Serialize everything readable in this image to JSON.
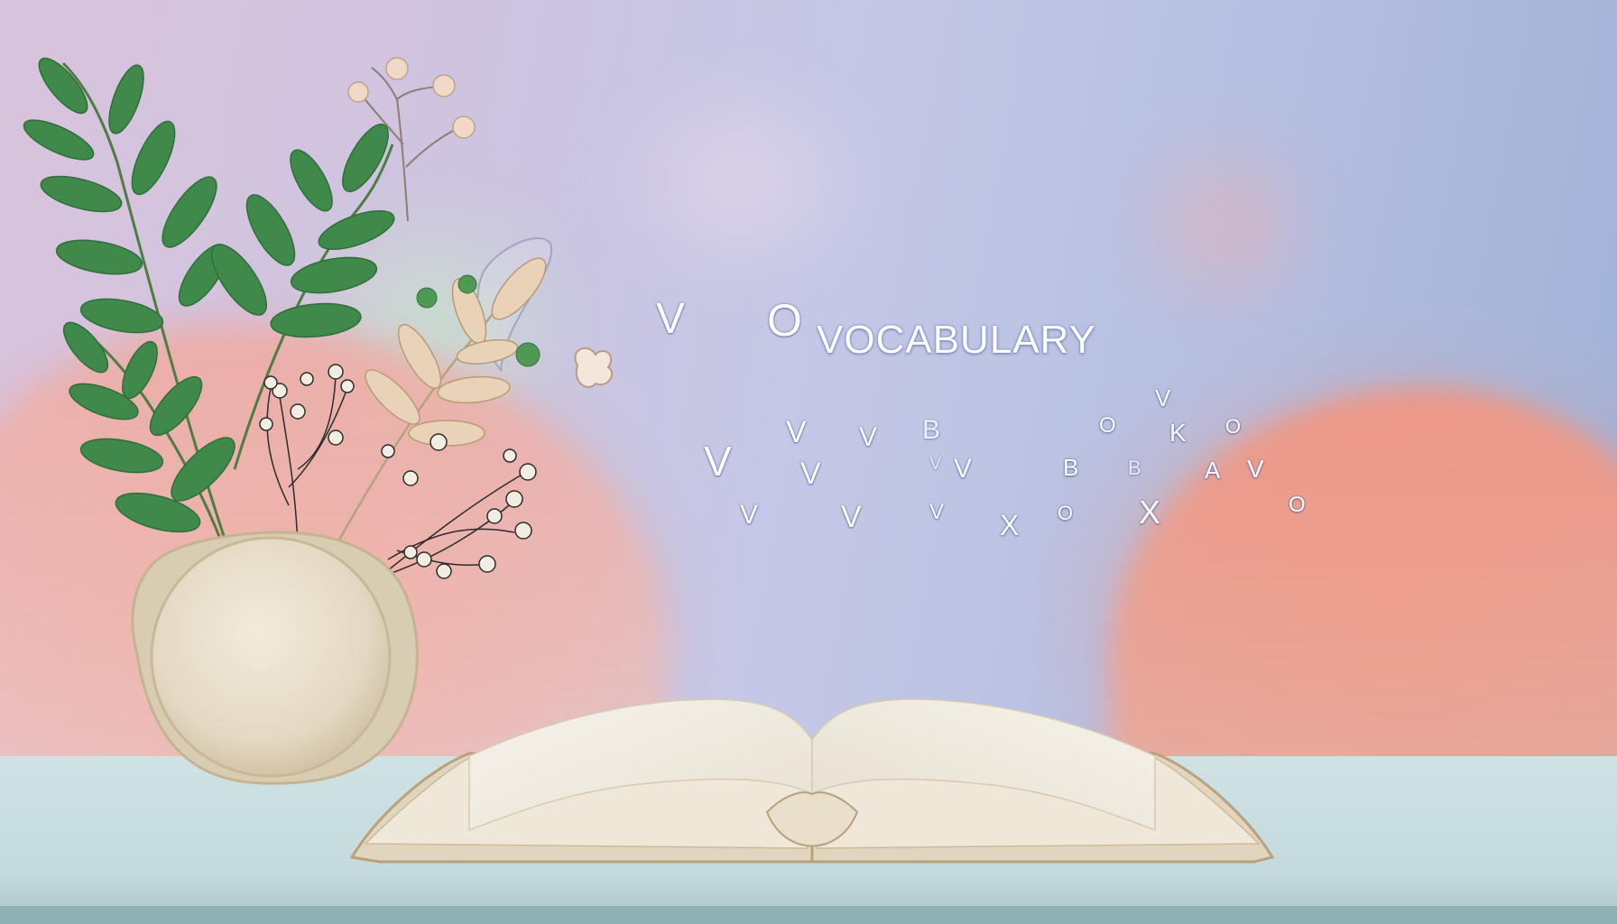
{
  "scene": {
    "title": "VOCABULARY",
    "colors": {
      "background_left": "#d9c3dc",
      "background_right": "#9fb0d6",
      "hill_peach": "#f1957f",
      "leaf_green": "#3f8a4a",
      "vase": "#e7dcc8",
      "table": "#c4dadd",
      "book_page": "#f4f0e6"
    },
    "floating_letters": [
      "V",
      "O",
      "V",
      "V",
      "V",
      "B",
      "V",
      "V",
      "V",
      "V",
      "V",
      "V",
      "B",
      "B",
      "O",
      "K",
      "O",
      "A",
      "V",
      "X",
      "O",
      "X",
      "O",
      "V"
    ]
  }
}
